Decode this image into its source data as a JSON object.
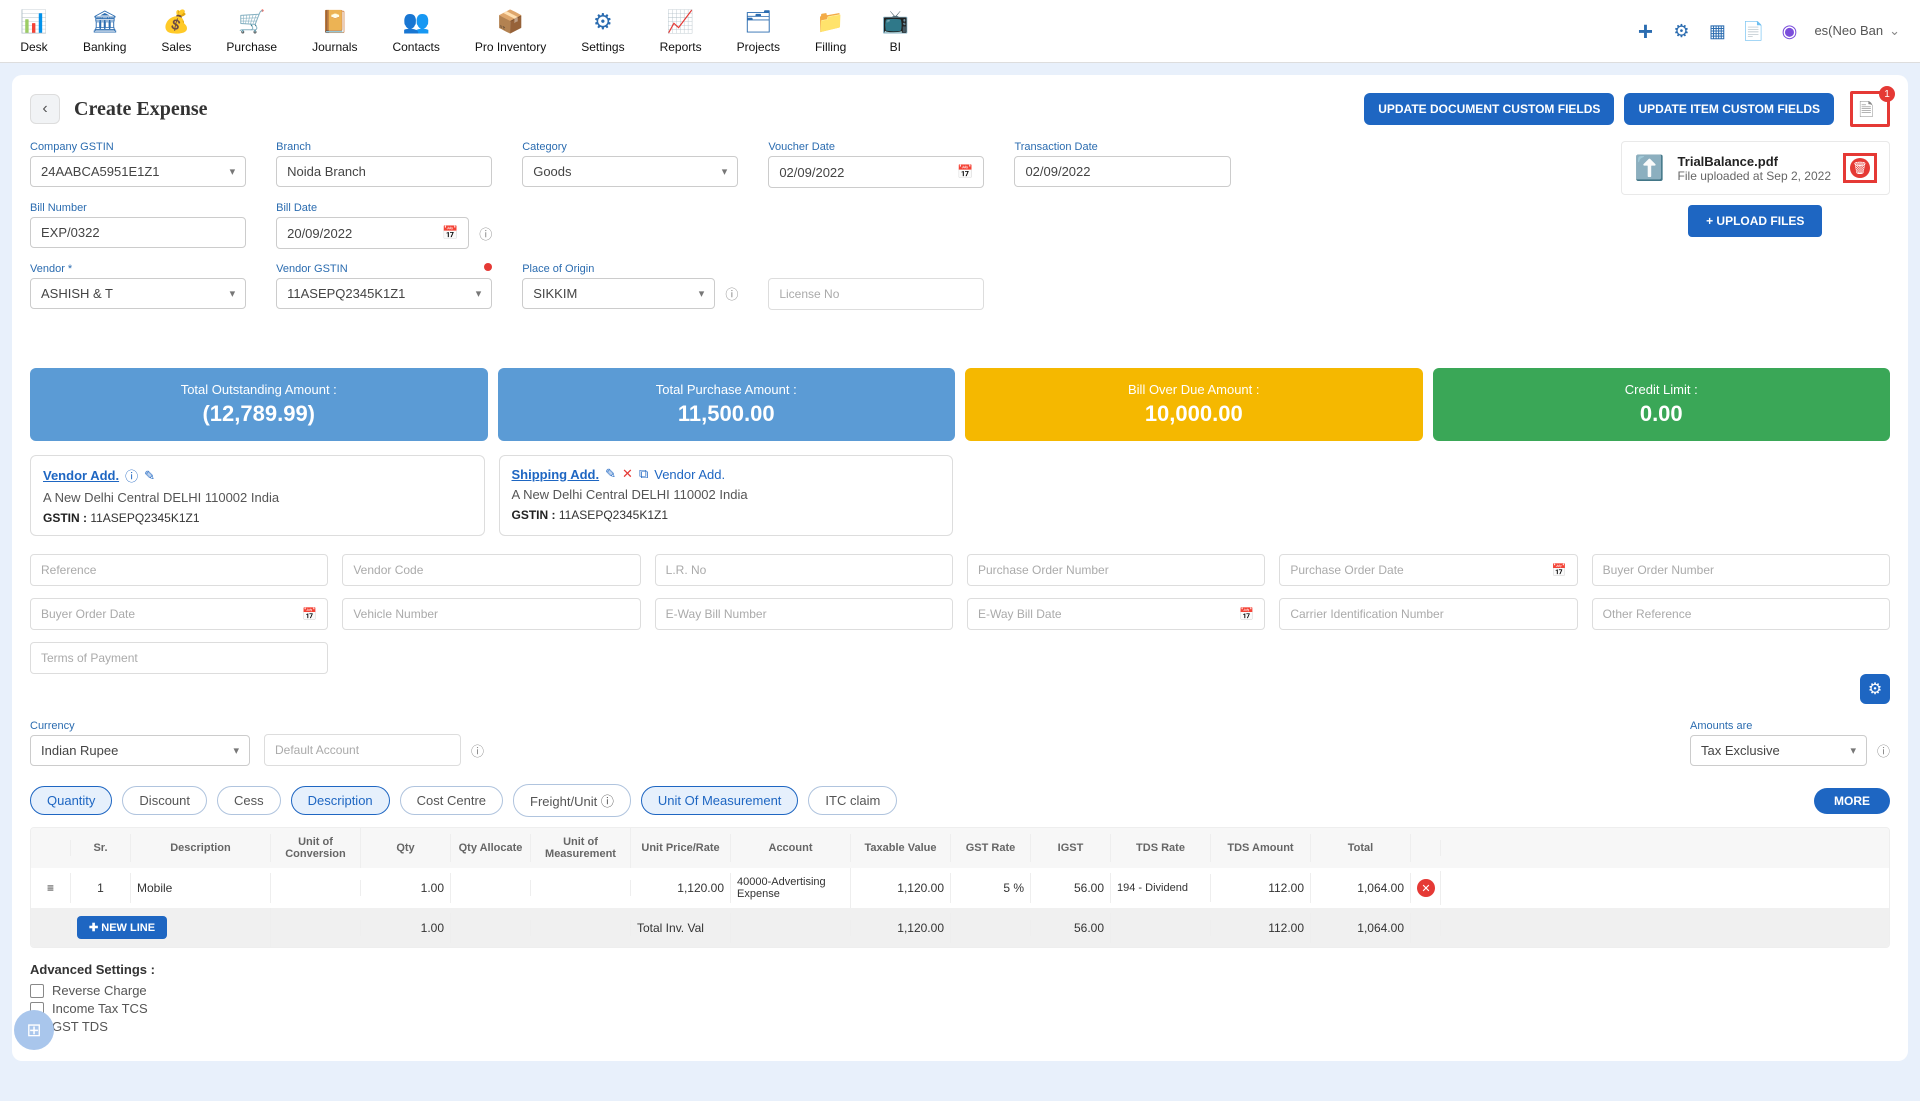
{
  "nav": [
    {
      "label": "Desk"
    },
    {
      "label": "Banking"
    },
    {
      "label": "Sales"
    },
    {
      "label": "Purchase"
    },
    {
      "label": "Journals"
    },
    {
      "label": "Contacts"
    },
    {
      "label": "Pro Inventory"
    },
    {
      "label": "Settings"
    },
    {
      "label": "Reports"
    },
    {
      "label": "Projects"
    },
    {
      "label": "Filling"
    },
    {
      "label": "BI"
    }
  ],
  "user": {
    "name": "es(Neo Ban"
  },
  "header": {
    "title": "Create Expense",
    "update_doc_btn": "UPDATE DOCUMENT CUSTOM FIELDS",
    "update_item_btn": "UPDATE ITEM CUSTOM FIELDS",
    "attach_badge": "1"
  },
  "fields": {
    "company_gstin": {
      "label": "Company GSTIN",
      "value": "24AABCA5951E1Z1"
    },
    "branch": {
      "label": "Branch",
      "value": "Noida Branch"
    },
    "category": {
      "label": "Category",
      "value": "Goods"
    },
    "voucher_date": {
      "label": "Voucher Date",
      "value": "02/09/2022"
    },
    "transaction_date": {
      "label": "Transaction Date",
      "value": "02/09/2022"
    },
    "bill_number": {
      "label": "Bill Number",
      "value": "EXP/0322"
    },
    "bill_date": {
      "label": "Bill Date",
      "value": "20/09/2022"
    },
    "vendor": {
      "label": "Vendor *",
      "value": "ASHISH & T"
    },
    "vendor_gstin": {
      "label": "Vendor GSTIN",
      "value": "11ASEPQ2345K1Z1"
    },
    "place_origin": {
      "label": "Place of Origin",
      "value": "SIKKIM"
    },
    "license": {
      "placeholder": "License No"
    }
  },
  "file": {
    "name": "TrialBalance.pdf",
    "sub": "File uploaded at Sep 2, 2022",
    "upload_btn": "+ UPLOAD FILES"
  },
  "kpi": {
    "outstanding": {
      "title": "Total Outstanding Amount :",
      "value": "(12,789.99)"
    },
    "purchase": {
      "title": "Total Purchase Amount :",
      "value": "11,500.00"
    },
    "overdue": {
      "title": "Bill Over Due Amount :",
      "value": "10,000.00"
    },
    "credit": {
      "title": "Credit Limit :",
      "value": "0.00"
    }
  },
  "vendor_addr": {
    "title": "Vendor Add.",
    "line": "A New Delhi Central DELHI 110002 India",
    "gst_label": "GSTIN :",
    "gst": "11ASEPQ2345K1Z1"
  },
  "ship_addr": {
    "title": "Shipping Add.",
    "vendor_link": "Vendor Add.",
    "line": "A New Delhi Central DELHI 110002 India",
    "gst_label": "GSTIN :",
    "gst": "11ASEPQ2345K1Z1"
  },
  "extra": {
    "reference": "Reference",
    "vendor_code": "Vendor Code",
    "lr_no": "L.R. No",
    "po_number": "Purchase Order Number",
    "po_date": "Purchase Order Date",
    "buyer_no": "Buyer Order Number",
    "buyer_date": "Buyer Order Date",
    "vehicle": "Vehicle Number",
    "eway": "E-Way Bill Number",
    "eway_date": "E-Way Bill Date",
    "carrier": "Carrier Identification Number",
    "other": "Other Reference",
    "terms": "Terms of Payment"
  },
  "currency": {
    "label": "Currency",
    "value": "Indian Rupee"
  },
  "default_acct": "Default Account",
  "amounts": {
    "label": "Amounts are",
    "value": "Tax Exclusive"
  },
  "pills": {
    "quantity": "Quantity",
    "discount": "Discount",
    "cess": "Cess",
    "description": "Description",
    "cost_centre": "Cost Centre",
    "freight": "Freight/Unit",
    "uom": "Unit Of Measurement",
    "itc": "ITC claim",
    "more": "MORE"
  },
  "table": {
    "headers": {
      "sr": "Sr.",
      "desc": "Description",
      "uoc": "Unit of Conversion",
      "qty": "Qty",
      "qty_alloc": "Qty Allocate",
      "uom": "Unit of Measurement",
      "unit_price": "Unit Price/Rate",
      "account": "Account",
      "taxable": "Taxable Value",
      "gst": "GST Rate",
      "igst": "IGST",
      "tds_rate": "TDS Rate",
      "tds_amt": "TDS Amount",
      "total": "Total"
    },
    "row": {
      "sr": "1",
      "desc": "Mobile",
      "qty": "1.00",
      "unit_price": "1,120.00",
      "account": "40000-Advertising Expense",
      "taxable": "1,120.00",
      "gst": "5 %",
      "igst": "56.00",
      "tds_rate": "194 - Dividend",
      "tds_amt": "112.00",
      "total": "1,064.00"
    },
    "newline": "NEW LINE",
    "footer": {
      "qty": "1.00",
      "label": "Total Inv. Val",
      "taxable": "1,120.00",
      "igst": "56.00",
      "tds_amt": "112.00",
      "total": "1,064.00"
    }
  },
  "advanced": {
    "title": "Advanced Settings :",
    "reverse": "Reverse Charge",
    "tcs": "Income Tax TCS",
    "gst_tds": "GST TDS"
  }
}
